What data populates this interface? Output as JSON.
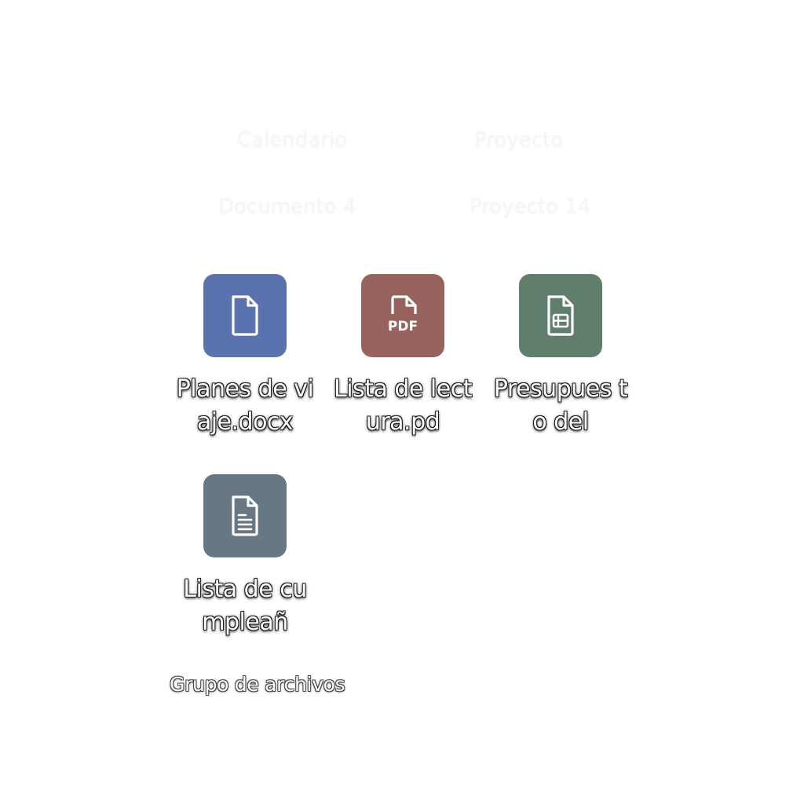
{
  "background_ghost_labels": [
    {
      "text": "Calendario"
    },
    {
      "text": "Proyecto"
    },
    {
      "text": "Documento 4"
    },
    {
      "text": "Proyecto 14"
    }
  ],
  "files": [
    {
      "label": "Planes de viaje.docx",
      "color": "#5a72ae",
      "icon": "document-icon"
    },
    {
      "label": "Lista de lectura.pd",
      "color": "#99635d",
      "icon": "pdf-icon"
    },
    {
      "label": "Presupues to del",
      "color": "#5f7e6c",
      "icon": "spreadsheet-icon"
    },
    {
      "label": "Lista de cumpleañ",
      "color": "#687784",
      "icon": "text-document-icon"
    }
  ],
  "group": {
    "label": "Grupo de archivos"
  }
}
